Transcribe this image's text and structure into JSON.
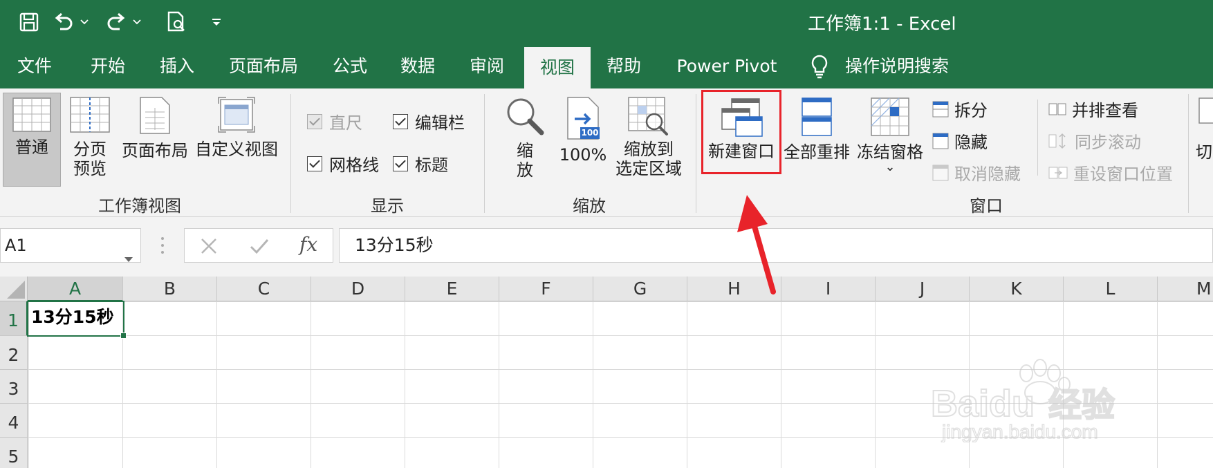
{
  "window": {
    "title": "工作簿1:1  -  Excel"
  },
  "tabs": [
    {
      "label": "文件"
    },
    {
      "label": "开始"
    },
    {
      "label": "插入"
    },
    {
      "label": "页面布局"
    },
    {
      "label": "公式"
    },
    {
      "label": "数据"
    },
    {
      "label": "审阅"
    },
    {
      "label": "视图",
      "active": true
    },
    {
      "label": "帮助"
    },
    {
      "label": "Power Pivot"
    }
  ],
  "search": {
    "label": "操作说明搜索",
    "icon": "lightbulb-icon"
  },
  "ribbon": {
    "workbook_views": {
      "label": "工作簿视图",
      "normal": "普通",
      "page_break_1": "分页",
      "page_break_2": "预览",
      "page_layout": "页面布局",
      "custom_views": "自定义视图"
    },
    "show": {
      "label": "显示",
      "ruler": "直尺",
      "formula_bar": "编辑栏",
      "gridlines": "网格线",
      "headings": "标题"
    },
    "zoom": {
      "label": "缩放",
      "zoom_1": "缩",
      "zoom_2": "放",
      "hundred": "100%",
      "hundred_badge": "100",
      "to_selection_1": "缩放到",
      "to_selection_2": "选定区域"
    },
    "window": {
      "label": "窗口",
      "new_window": "新建窗口",
      "arrange_all": "全部重排",
      "freeze_panes": "冻结窗格",
      "freeze_chevron": "⌄",
      "split": "拆分",
      "hide": "隐藏",
      "unhide": "取消隐藏",
      "side_by_side": "并排查看",
      "sync_scroll": "同步滚动",
      "reset_position": "重设窗口位置",
      "switch_windows": "切"
    }
  },
  "formula_bar": {
    "name_box": "A1",
    "fx": "fx",
    "content": "13分15秒"
  },
  "sheet": {
    "columns": [
      "A",
      "B",
      "C",
      "D",
      "E",
      "F",
      "G",
      "H",
      "I",
      "J",
      "K",
      "L",
      "M"
    ],
    "rows": [
      "1",
      "2",
      "3",
      "4",
      "5"
    ],
    "cells": {
      "A1": "13分15秒"
    }
  },
  "watermark": {
    "brand": "Baidu",
    "brand_cn": "经验",
    "url": "jingyan.baidu.com"
  },
  "colors": {
    "accent": "#217346",
    "highlight": "#e8232a"
  }
}
